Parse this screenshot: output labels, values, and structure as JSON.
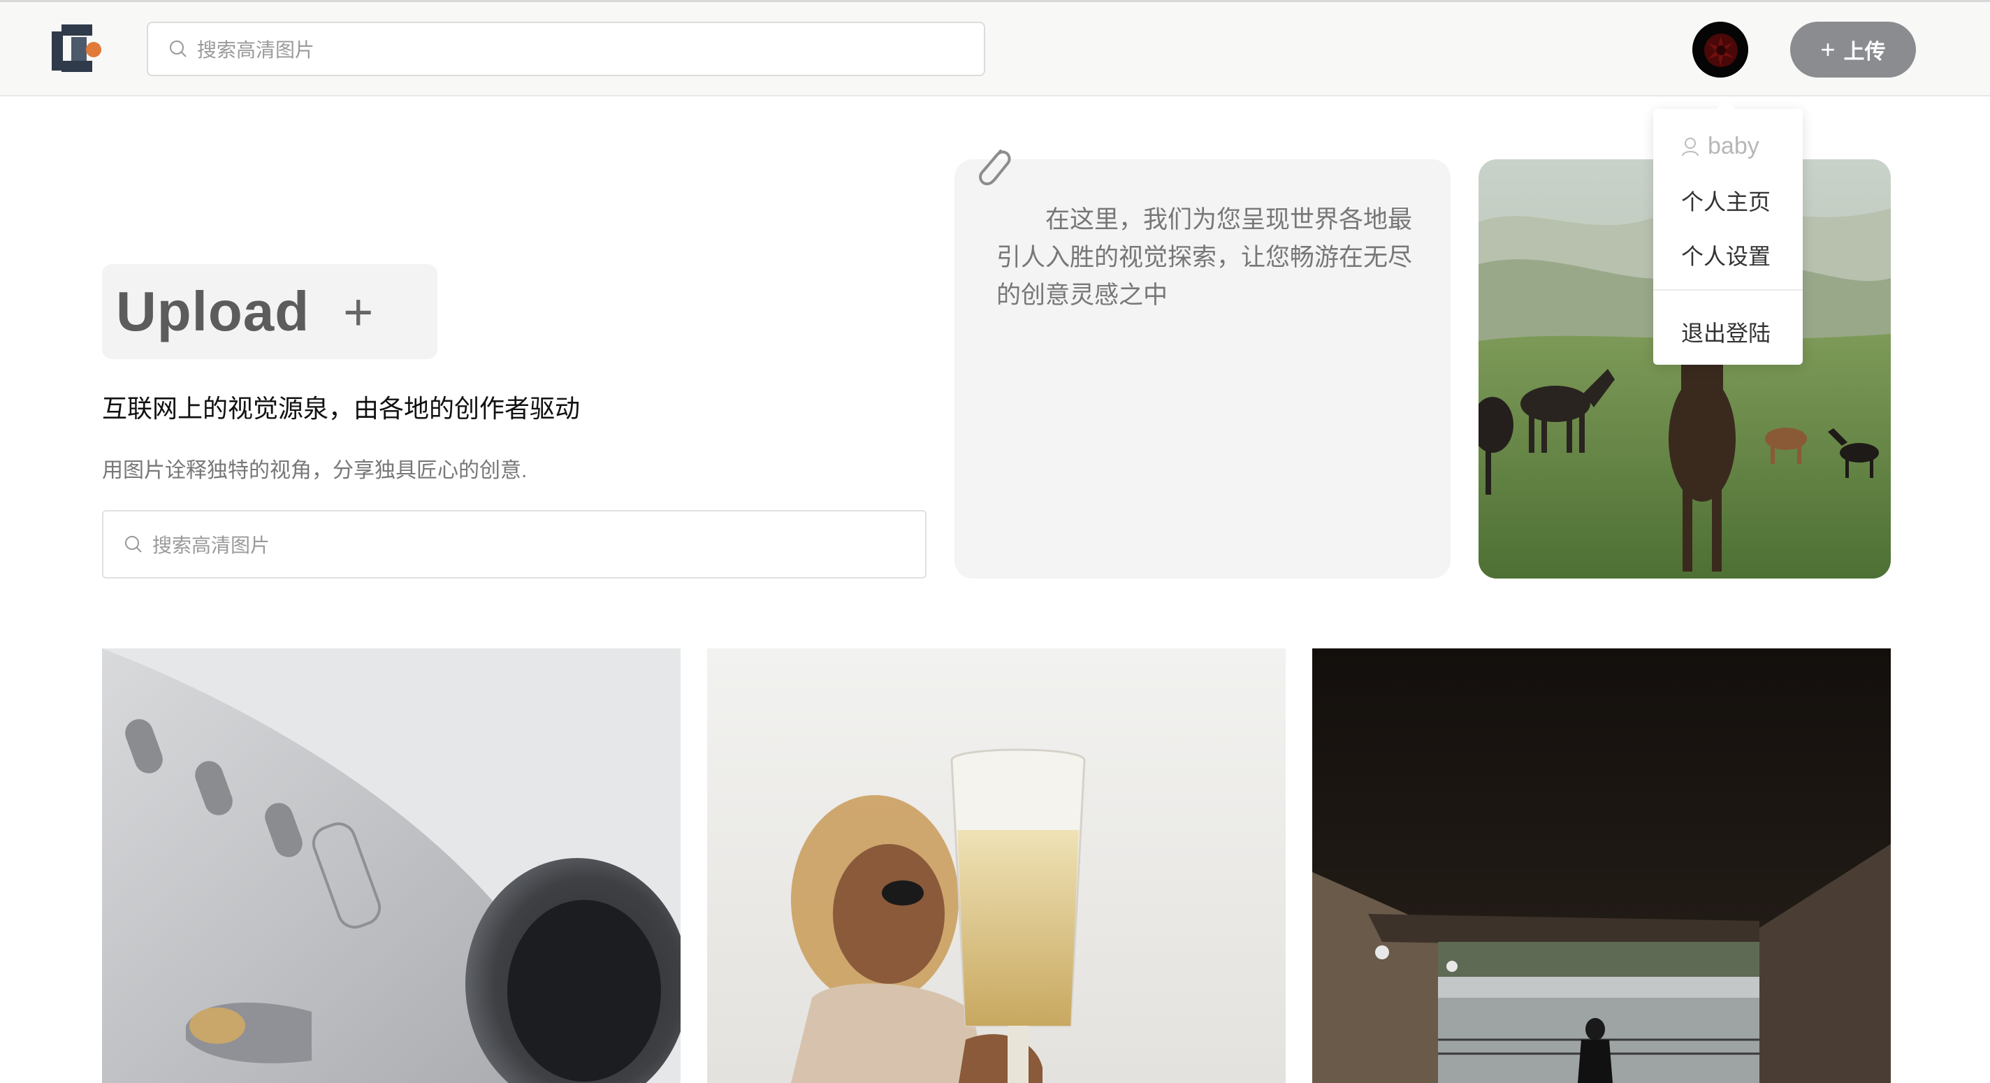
{
  "header": {
    "search_placeholder": "搜索高清图片",
    "upload_button_label": "上传"
  },
  "user_menu": {
    "username": "baby",
    "items": [
      "个人主页",
      "个人设置"
    ],
    "logout_label": "退出登陆"
  },
  "hero": {
    "upload_title": "Upload",
    "heading": "互联网上的视觉源泉，由各地的创作者驱动",
    "subheading": "用图片诠释独特的视角，分享独具匠心的创意.",
    "search_placeholder": "搜索高清图片"
  },
  "quote_card": {
    "text": "在这里，我们为您呈现世界各地最引人入胜的视觉探索，让您畅游在无尽的创意灵感之中"
  },
  "colors": {
    "logo_dark": "#2f3a4a",
    "logo_accent": "#e07a3a",
    "upload_button_bg": "#8a8c90"
  }
}
